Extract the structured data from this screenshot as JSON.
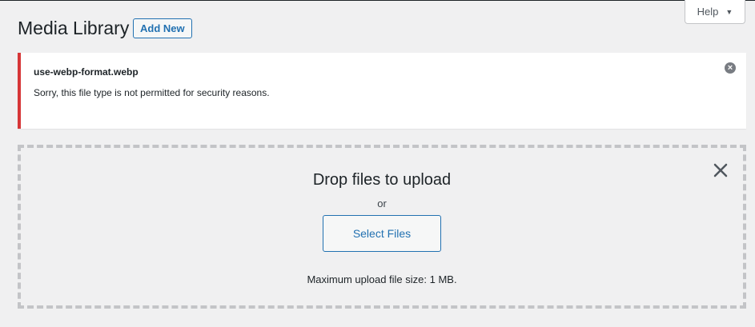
{
  "header": {
    "title": "Media Library",
    "add_new_label": "Add New",
    "help_label": "Help"
  },
  "notice": {
    "filename": "use-webp-format.webp",
    "message": "Sorry, this file type is not permitted for security reasons.",
    "status_color": "#d63638",
    "dismiss_icon": "dismiss-circle-x"
  },
  "uploader": {
    "title": "Drop files to upload",
    "or_text": "or",
    "select_label": "Select Files",
    "max_size_text": "Maximum upload file size: 1 MB.",
    "close_icon": "close-x"
  },
  "colors": {
    "accent": "#2271b1",
    "background": "#f0f0f1",
    "error": "#d63638"
  }
}
